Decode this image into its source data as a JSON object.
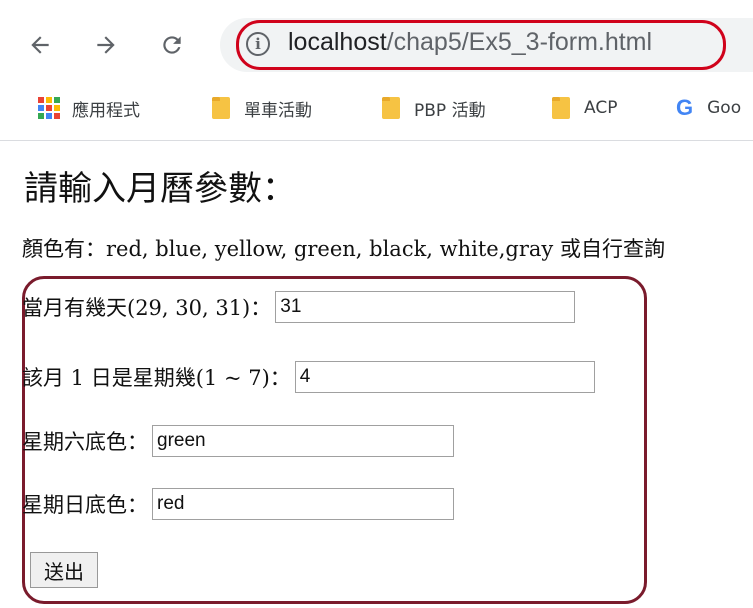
{
  "browser": {
    "url_host": "localhost",
    "url_path": "/chap5/Ex5_3-form.html",
    "info_glyph": "i"
  },
  "bookmarks": [
    {
      "label": "應用程式",
      "icon": "apps-grid-icon"
    },
    {
      "label": "單車活動",
      "icon": "folder-icon"
    },
    {
      "label": "PBP 活動",
      "icon": "folder-icon"
    },
    {
      "label": "ACP",
      "icon": "folder-icon"
    },
    {
      "label": "Goo",
      "icon": "google-icon"
    }
  ],
  "google_glyph": "G",
  "page": {
    "heading": "請輸入月曆參數：",
    "colors_note": "顏色有：red, blue, yellow, green, black, white,gray 或自行查詢",
    "fields": {
      "days_label": "當月有幾天(29, 30, 31)：",
      "days_value": "31",
      "first_label": "該月 1 日是星期幾(1 ~ 7)：",
      "first_value": "4",
      "sat_label": "星期六底色：",
      "sat_value": "green",
      "sun_label": "星期日底色：",
      "sun_value": "red"
    },
    "submit_label": "送出"
  },
  "colors": {
    "url_highlight": "#d0021b",
    "form_highlight": "#7a1b2c"
  }
}
